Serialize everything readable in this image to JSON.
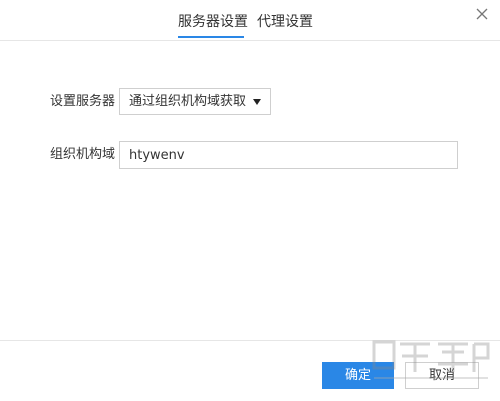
{
  "tabs": [
    {
      "label": "服务器设置",
      "active": true
    },
    {
      "label": "代理设置",
      "active": false
    }
  ],
  "form": {
    "server_label": "设置服务器",
    "server_select_value": "通过组织机构域获取",
    "domain_label": "组织机构域",
    "domain_value": "htywenv"
  },
  "footer": {
    "ok_label": "确定",
    "cancel_label": "取消"
  },
  "colors": {
    "accent": "#2a87e6",
    "border": "#cfcfcf",
    "divider": "#e6e6e6"
  },
  "icons": {
    "close": "close-icon",
    "dropdown": "dropdown-caret-icon"
  },
  "watermark": {
    "text": "下载吧",
    "url_text": "www.xiazaiba.com"
  }
}
